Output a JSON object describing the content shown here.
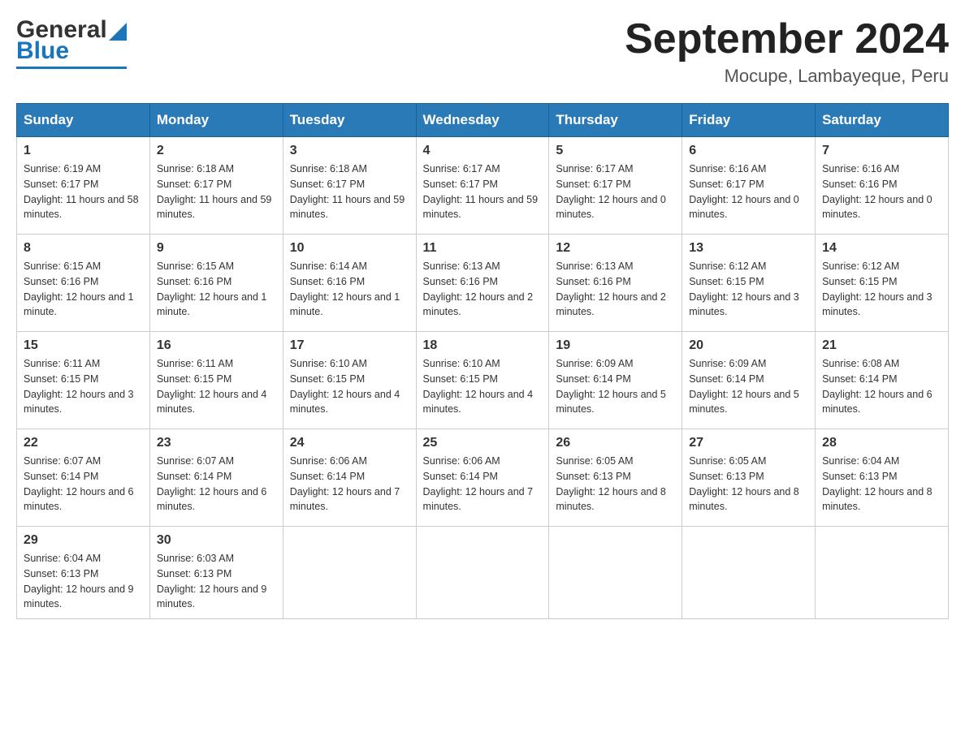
{
  "header": {
    "logo_general": "General",
    "logo_blue": "Blue",
    "month_title": "September 2024",
    "location": "Mocupe, Lambayeque, Peru"
  },
  "days_of_week": [
    "Sunday",
    "Monday",
    "Tuesday",
    "Wednesday",
    "Thursday",
    "Friday",
    "Saturday"
  ],
  "weeks": [
    [
      {
        "day": "1",
        "sunrise": "Sunrise: 6:19 AM",
        "sunset": "Sunset: 6:17 PM",
        "daylight": "Daylight: 11 hours and 58 minutes."
      },
      {
        "day": "2",
        "sunrise": "Sunrise: 6:18 AM",
        "sunset": "Sunset: 6:17 PM",
        "daylight": "Daylight: 11 hours and 59 minutes."
      },
      {
        "day": "3",
        "sunrise": "Sunrise: 6:18 AM",
        "sunset": "Sunset: 6:17 PM",
        "daylight": "Daylight: 11 hours and 59 minutes."
      },
      {
        "day": "4",
        "sunrise": "Sunrise: 6:17 AM",
        "sunset": "Sunset: 6:17 PM",
        "daylight": "Daylight: 11 hours and 59 minutes."
      },
      {
        "day": "5",
        "sunrise": "Sunrise: 6:17 AM",
        "sunset": "Sunset: 6:17 PM",
        "daylight": "Daylight: 12 hours and 0 minutes."
      },
      {
        "day": "6",
        "sunrise": "Sunrise: 6:16 AM",
        "sunset": "Sunset: 6:17 PM",
        "daylight": "Daylight: 12 hours and 0 minutes."
      },
      {
        "day": "7",
        "sunrise": "Sunrise: 6:16 AM",
        "sunset": "Sunset: 6:16 PM",
        "daylight": "Daylight: 12 hours and 0 minutes."
      }
    ],
    [
      {
        "day": "8",
        "sunrise": "Sunrise: 6:15 AM",
        "sunset": "Sunset: 6:16 PM",
        "daylight": "Daylight: 12 hours and 1 minute."
      },
      {
        "day": "9",
        "sunrise": "Sunrise: 6:15 AM",
        "sunset": "Sunset: 6:16 PM",
        "daylight": "Daylight: 12 hours and 1 minute."
      },
      {
        "day": "10",
        "sunrise": "Sunrise: 6:14 AM",
        "sunset": "Sunset: 6:16 PM",
        "daylight": "Daylight: 12 hours and 1 minute."
      },
      {
        "day": "11",
        "sunrise": "Sunrise: 6:13 AM",
        "sunset": "Sunset: 6:16 PM",
        "daylight": "Daylight: 12 hours and 2 minutes."
      },
      {
        "day": "12",
        "sunrise": "Sunrise: 6:13 AM",
        "sunset": "Sunset: 6:16 PM",
        "daylight": "Daylight: 12 hours and 2 minutes."
      },
      {
        "day": "13",
        "sunrise": "Sunrise: 6:12 AM",
        "sunset": "Sunset: 6:15 PM",
        "daylight": "Daylight: 12 hours and 3 minutes."
      },
      {
        "day": "14",
        "sunrise": "Sunrise: 6:12 AM",
        "sunset": "Sunset: 6:15 PM",
        "daylight": "Daylight: 12 hours and 3 minutes."
      }
    ],
    [
      {
        "day": "15",
        "sunrise": "Sunrise: 6:11 AM",
        "sunset": "Sunset: 6:15 PM",
        "daylight": "Daylight: 12 hours and 3 minutes."
      },
      {
        "day": "16",
        "sunrise": "Sunrise: 6:11 AM",
        "sunset": "Sunset: 6:15 PM",
        "daylight": "Daylight: 12 hours and 4 minutes."
      },
      {
        "day": "17",
        "sunrise": "Sunrise: 6:10 AM",
        "sunset": "Sunset: 6:15 PM",
        "daylight": "Daylight: 12 hours and 4 minutes."
      },
      {
        "day": "18",
        "sunrise": "Sunrise: 6:10 AM",
        "sunset": "Sunset: 6:15 PM",
        "daylight": "Daylight: 12 hours and 4 minutes."
      },
      {
        "day": "19",
        "sunrise": "Sunrise: 6:09 AM",
        "sunset": "Sunset: 6:14 PM",
        "daylight": "Daylight: 12 hours and 5 minutes."
      },
      {
        "day": "20",
        "sunrise": "Sunrise: 6:09 AM",
        "sunset": "Sunset: 6:14 PM",
        "daylight": "Daylight: 12 hours and 5 minutes."
      },
      {
        "day": "21",
        "sunrise": "Sunrise: 6:08 AM",
        "sunset": "Sunset: 6:14 PM",
        "daylight": "Daylight: 12 hours and 6 minutes."
      }
    ],
    [
      {
        "day": "22",
        "sunrise": "Sunrise: 6:07 AM",
        "sunset": "Sunset: 6:14 PM",
        "daylight": "Daylight: 12 hours and 6 minutes."
      },
      {
        "day": "23",
        "sunrise": "Sunrise: 6:07 AM",
        "sunset": "Sunset: 6:14 PM",
        "daylight": "Daylight: 12 hours and 6 minutes."
      },
      {
        "day": "24",
        "sunrise": "Sunrise: 6:06 AM",
        "sunset": "Sunset: 6:14 PM",
        "daylight": "Daylight: 12 hours and 7 minutes."
      },
      {
        "day": "25",
        "sunrise": "Sunrise: 6:06 AM",
        "sunset": "Sunset: 6:14 PM",
        "daylight": "Daylight: 12 hours and 7 minutes."
      },
      {
        "day": "26",
        "sunrise": "Sunrise: 6:05 AM",
        "sunset": "Sunset: 6:13 PM",
        "daylight": "Daylight: 12 hours and 8 minutes."
      },
      {
        "day": "27",
        "sunrise": "Sunrise: 6:05 AM",
        "sunset": "Sunset: 6:13 PM",
        "daylight": "Daylight: 12 hours and 8 minutes."
      },
      {
        "day": "28",
        "sunrise": "Sunrise: 6:04 AM",
        "sunset": "Sunset: 6:13 PM",
        "daylight": "Daylight: 12 hours and 8 minutes."
      }
    ],
    [
      {
        "day": "29",
        "sunrise": "Sunrise: 6:04 AM",
        "sunset": "Sunset: 6:13 PM",
        "daylight": "Daylight: 12 hours and 9 minutes."
      },
      {
        "day": "30",
        "sunrise": "Sunrise: 6:03 AM",
        "sunset": "Sunset: 6:13 PM",
        "daylight": "Daylight: 12 hours and 9 minutes."
      },
      null,
      null,
      null,
      null,
      null
    ]
  ]
}
